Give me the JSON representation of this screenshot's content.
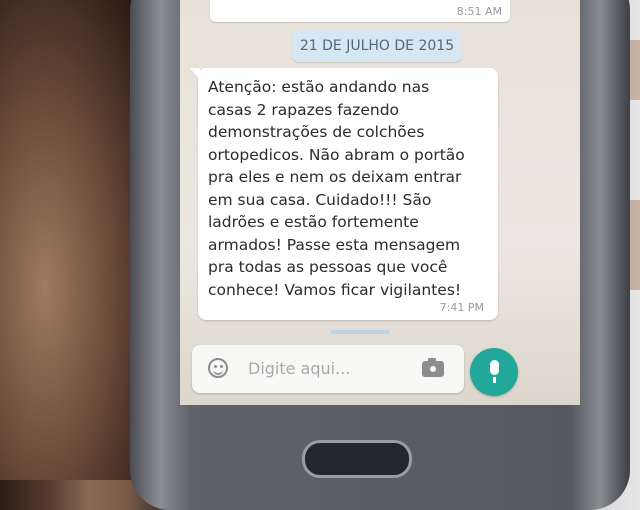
{
  "chat": {
    "previous_message_time": "8:51 AM",
    "date_divider": "21 DE JULHO DE 2015",
    "message": {
      "text": "Atenção: estão andando nas\ncasas 2 rapazes fazendo\ndemonstrações de colchões\nortopedicos. Não abram o portão\npra eles e nem os deixam entrar\nem sua casa. Cuidado!!! São\nladrões e estão fortemente\narmados! Passe esta mensagem\npra todas as pessoas que você\nconhece! Vamos ficar vigilantes!",
      "time": "7:41 PM"
    }
  },
  "composer": {
    "placeholder": "Digite aqui...",
    "emoji_icon": "emoji-icon",
    "camera_icon": "camera-icon",
    "mic_icon": "mic-icon"
  },
  "colors": {
    "accent": "#21a89a",
    "date_chip": "#d6e6f2",
    "chat_background": "#e9e4dc",
    "bubble": "#ffffff"
  }
}
